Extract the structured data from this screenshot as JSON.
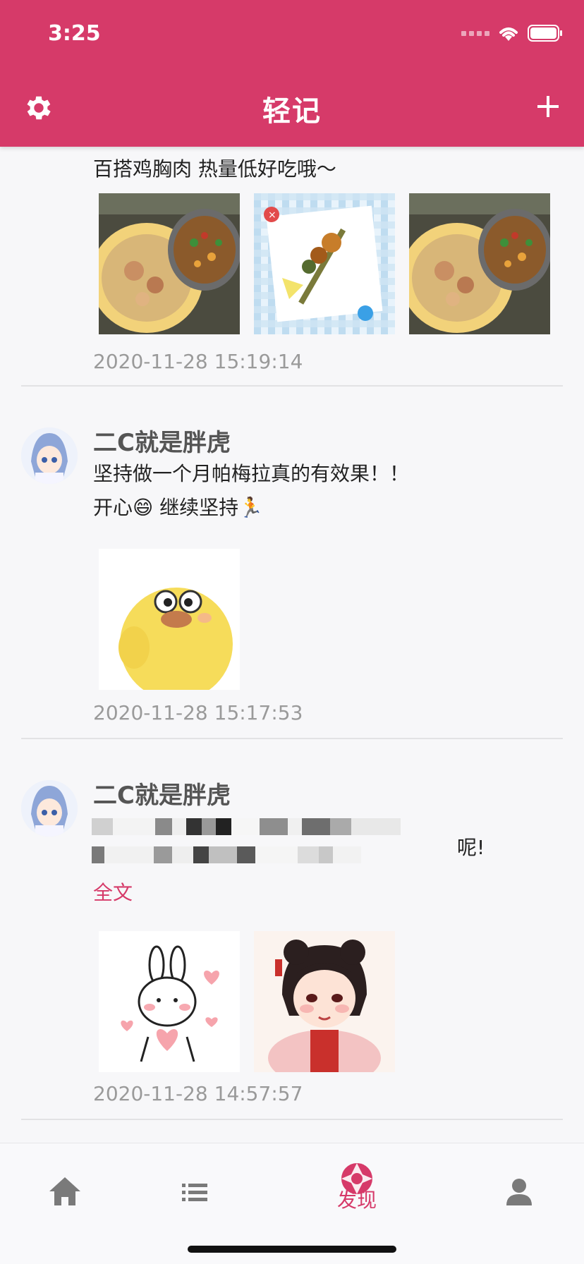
{
  "status": {
    "time": "3:25"
  },
  "header": {
    "title": "轻记",
    "settings_icon": "gear-icon",
    "add_icon": "plus-icon"
  },
  "colors": {
    "accent": "#d63a69",
    "text_muted": "#9a9a9a"
  },
  "posts": [
    {
      "text_lines": [
        "百搭鸡胸肉 热量低好吃哦～"
      ],
      "images": [
        "food-plate-photo",
        "skewer-sticker",
        "food-plate-photo"
      ],
      "timestamp": "2020-11-28 15:19:14"
    },
    {
      "user": "二C就是胖虎",
      "text_lines": [
        "坚持做一个月帕梅拉真的有效果！！",
        "开心😄 继续坚持🏃"
      ],
      "images": [
        "yellow-duck-sticker"
      ],
      "timestamp": "2020-11-28 15:17:53"
    },
    {
      "user": "二C就是胖虎",
      "text_end": "呢!",
      "more_label": "全文",
      "images": [
        "bunny-hearts-sticker",
        "girl-illustration"
      ],
      "timestamp": "2020-11-28 14:57:57"
    }
  ],
  "tabbar": {
    "items": [
      {
        "icon": "home-icon",
        "label": ""
      },
      {
        "icon": "list-icon",
        "label": ""
      },
      {
        "icon": "aperture-icon",
        "label": "发现",
        "active": true
      },
      {
        "icon": "person-icon",
        "label": ""
      }
    ]
  }
}
